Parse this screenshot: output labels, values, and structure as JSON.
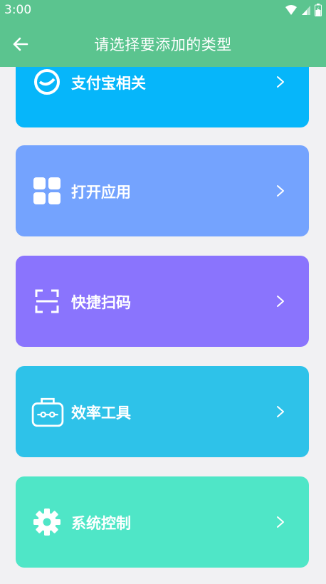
{
  "status_bar": {
    "time": "3:00"
  },
  "app_bar": {
    "title": "请选择要添加的类型"
  },
  "cards": [
    {
      "label": "支付宝相关",
      "color": "#06b6fa",
      "icon": "alipay-icon"
    },
    {
      "label": "打开应用",
      "color": "#74a3fe",
      "icon": "apps-grid-icon"
    },
    {
      "label": "快捷扫码",
      "color": "#8a74fd",
      "icon": "scan-icon"
    },
    {
      "label": "效率工具",
      "color": "#2ec2e9",
      "icon": "toolbox-icon"
    },
    {
      "label": "系统控制",
      "color": "#4fe6c7",
      "icon": "gear-icon"
    }
  ]
}
